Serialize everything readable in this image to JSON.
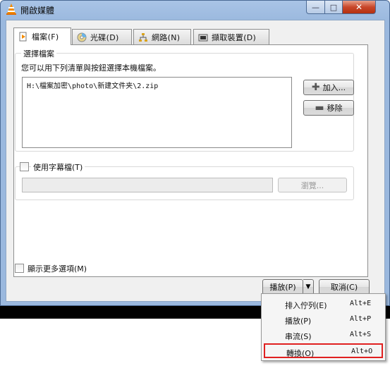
{
  "window": {
    "title": "開啟媒體"
  },
  "tabs": [
    {
      "label": "檔案(F)",
      "icon": "file-icon"
    },
    {
      "label": "光碟(D)",
      "icon": "disc-icon"
    },
    {
      "label": "網路(N)",
      "icon": "network-icon"
    },
    {
      "label": "擷取裝置(D)",
      "icon": "capture-device-icon"
    }
  ],
  "file_group": {
    "title": "選擇檔案",
    "description": "您可以用下列清單與按鈕選擇本機檔案。",
    "files": [
      "H:\\檔案加密\\photo\\新建文件夹\\2.zip"
    ],
    "add_label": "加入...",
    "remove_label": "移除"
  },
  "subtitle_group": {
    "checkbox_label": "使用字幕檔(T)",
    "browse_label": "瀏覽..."
  },
  "more_options_label": "顯示更多選項(M)",
  "buttons": {
    "play": "播放(P)",
    "cancel": "取消(C)"
  },
  "menu": [
    {
      "label": "排入佇列(E)",
      "shortcut": "Alt+E"
    },
    {
      "label": "播放(P)",
      "shortcut": "Alt+P"
    },
    {
      "label": "串流(S)",
      "shortcut": "Alt+S"
    },
    {
      "label": "轉換(O)",
      "shortcut": "Alt+O"
    }
  ],
  "colors": {
    "highlight_box": "#e02020",
    "title_bar": "#9ab8de"
  }
}
